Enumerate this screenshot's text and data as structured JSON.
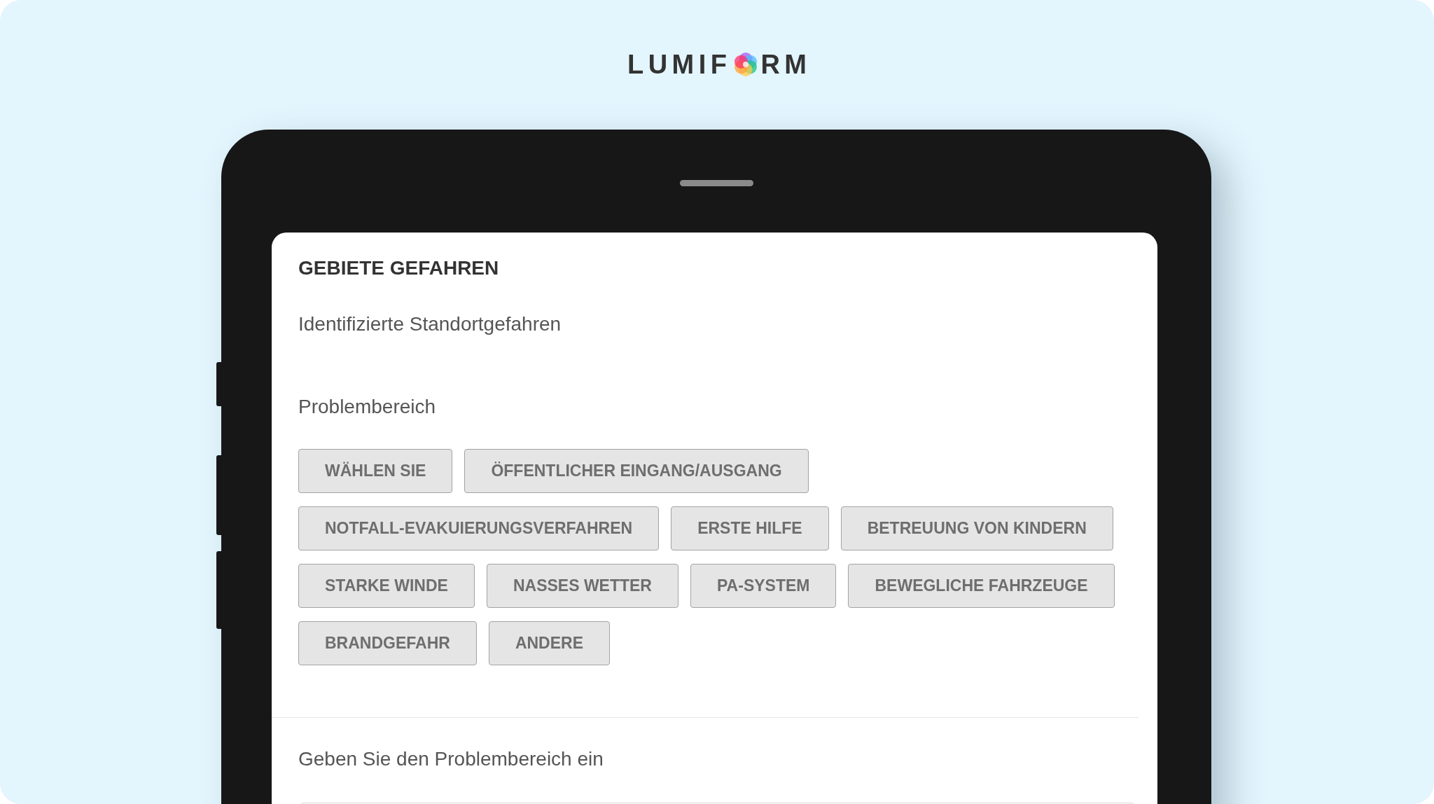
{
  "logo": {
    "text_before": "LUMIF",
    "text_after": "RM"
  },
  "form": {
    "title": "GEBIETE GEFAHREN",
    "subtitle": "Identifizierte Standortgefahren",
    "question": {
      "label": "Problembereich",
      "options": [
        {
          "label": "WÄHLEN SIE",
          "selected": false
        },
        {
          "label": "ÖFFENTLICHER EINGANG/AUSGANG",
          "selected": false
        },
        {
          "label": "NOTFALL-EVAKUIERUNGSVERFAHREN",
          "selected": false
        },
        {
          "label": "ERSTE HILFE",
          "selected": false
        },
        {
          "label": "BETREUUNG VON KINDERN",
          "selected": false
        },
        {
          "label": "STARKE WINDE",
          "selected": false
        },
        {
          "label": "NASSES WETTER",
          "selected": false
        },
        {
          "label": "PA-SYSTEM",
          "selected": false
        },
        {
          "label": "BEWEGLICHE FAHRZEUGE",
          "selected": false
        },
        {
          "label": "BRANDGEFAHR",
          "selected": false
        },
        {
          "label": "ANDERE",
          "selected": false
        }
      ]
    },
    "text_question": {
      "label": "Geben Sie den Problembereich ein"
    }
  }
}
